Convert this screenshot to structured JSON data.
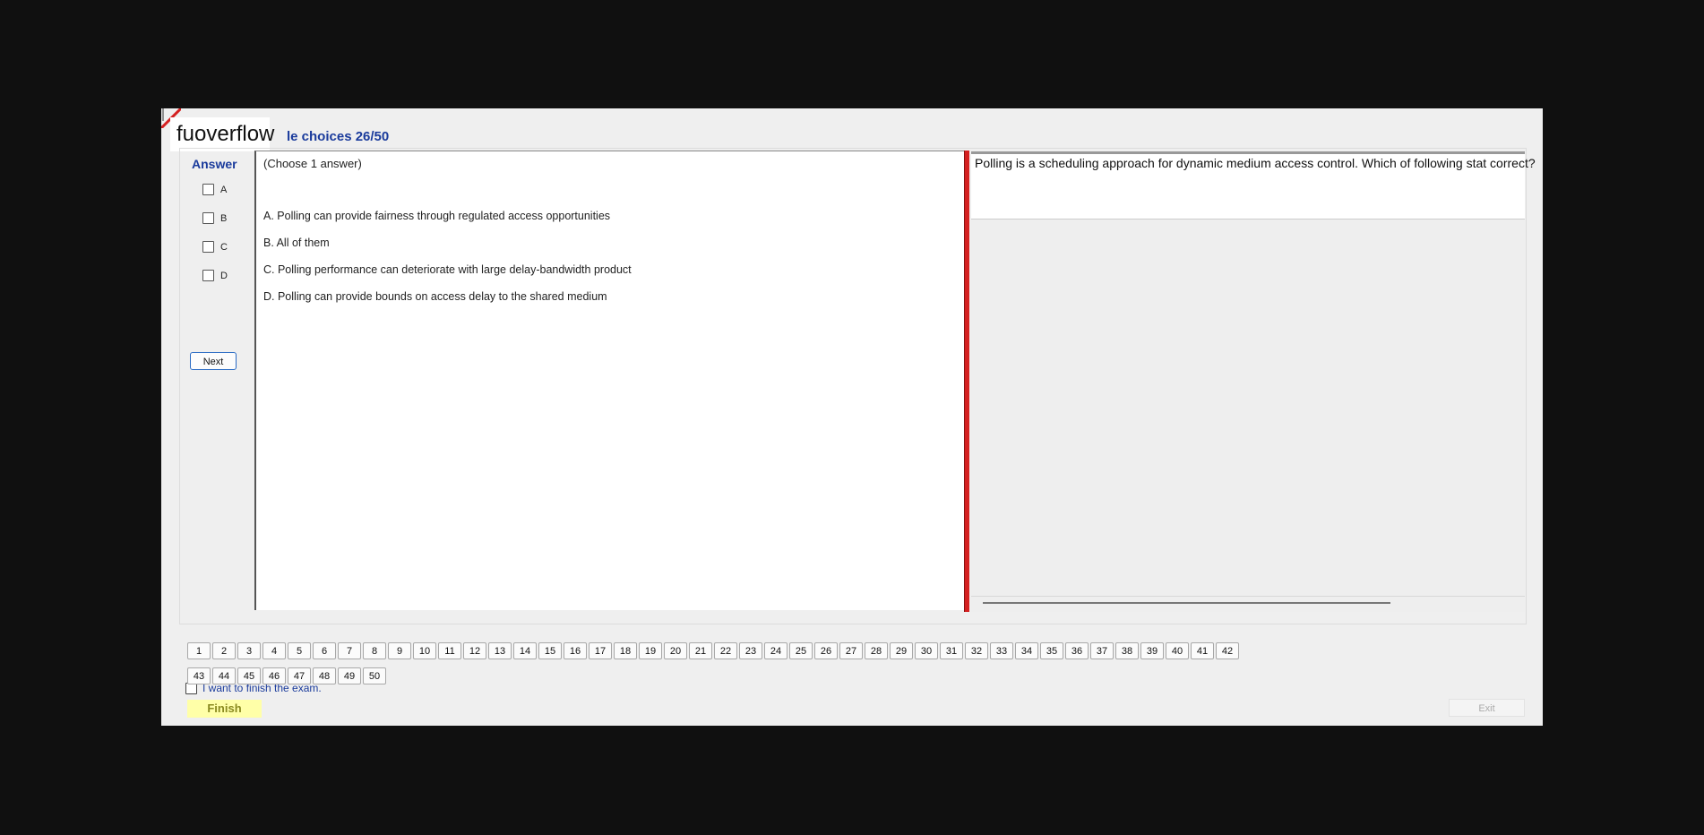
{
  "watermark": "fuoverflow",
  "title": "le choices 26/50",
  "answer_label": "Answer",
  "options": [
    "A",
    "B",
    "C",
    "D"
  ],
  "next_label": "Next",
  "question": {
    "note": "(Choose 1 answer)",
    "choices": [
      "A.  Polling can provide fairness through regulated access opportunities",
      "B.  All of them",
      "C.  Polling performance can deteriorate with large delay-bandwidth product",
      "D.  Polling can provide bounds on access delay to the shared medium"
    ],
    "stem": "Polling is a scheduling approach for dynamic medium access control. Which of following stat correct?"
  },
  "question_numbers": [
    "1",
    "2",
    "3",
    "4",
    "5",
    "6",
    "7",
    "8",
    "9",
    "10",
    "11",
    "12",
    "13",
    "14",
    "15",
    "16",
    "17",
    "18",
    "19",
    "20",
    "21",
    "22",
    "23",
    "24",
    "25",
    "26",
    "27",
    "28",
    "29",
    "30",
    "31",
    "32",
    "33",
    "34",
    "35",
    "36",
    "37",
    "38",
    "39",
    "40",
    "41",
    "42",
    "43",
    "44",
    "45",
    "46",
    "47",
    "48",
    "49",
    "50"
  ],
  "finish_check_label": "I want to finish the exam.",
  "finish_label": "Finish",
  "exit_label": "Exit",
  "colors": {
    "accent": "#1a3b9c",
    "divider": "#d42020",
    "finish_bg": "#ffffa8"
  }
}
